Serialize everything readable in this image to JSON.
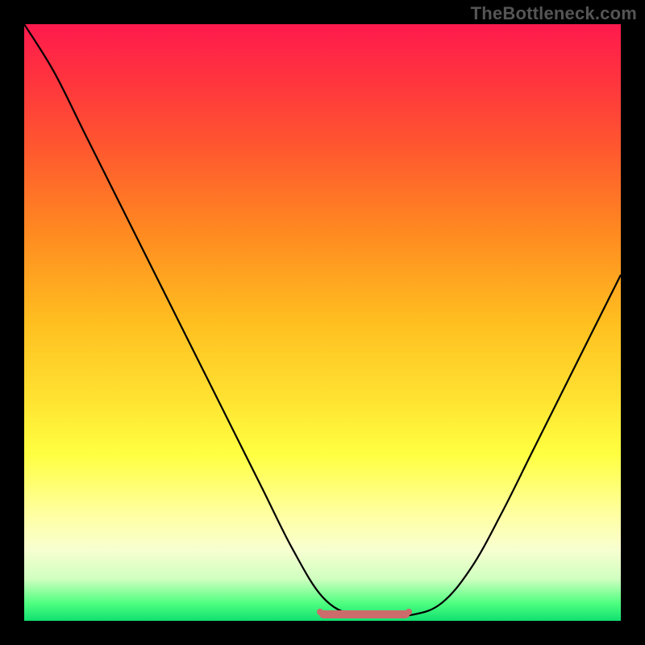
{
  "watermark": "TheBottleneck.com",
  "chart_data": {
    "type": "line",
    "title": "",
    "xlabel": "",
    "ylabel": "",
    "xlim": [
      0,
      100
    ],
    "ylim": [
      0,
      100
    ],
    "series": [
      {
        "name": "bottleneck-curve",
        "x": [
          0,
          5,
          10,
          15,
          20,
          25,
          30,
          35,
          40,
          45,
          50,
          55,
          60,
          65,
          70,
          75,
          80,
          85,
          90,
          95,
          100
        ],
        "y": [
          100,
          92,
          82,
          72,
          62,
          52,
          42,
          32,
          22,
          12,
          4,
          1,
          1,
          1,
          3,
          9,
          18,
          28,
          38,
          48,
          58
        ]
      }
    ],
    "optimal_range": {
      "x_start": 50,
      "x_end": 64,
      "y": 1
    },
    "colors": {
      "curve": "#000000",
      "optimal_marker": "#cc6b6b",
      "gradient_top": "#ff1a4d",
      "gradient_bottom": "#10e070",
      "frame": "#000000"
    }
  }
}
